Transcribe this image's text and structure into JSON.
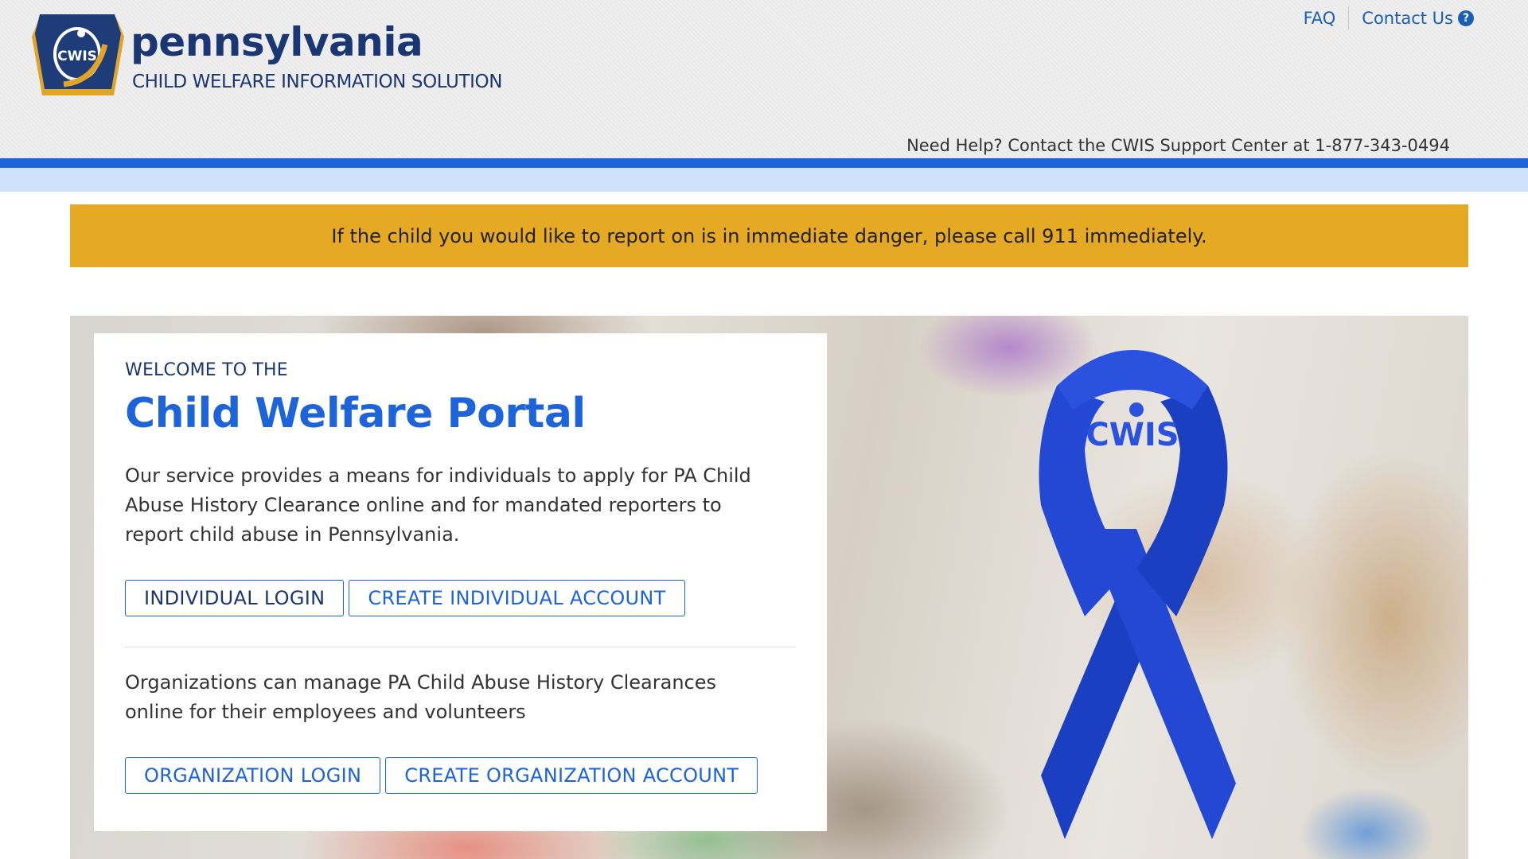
{
  "header": {
    "logo": {
      "state_name": "pennsylvania",
      "subtitle": "CHILD WELFARE INFORMATION SOLUTION",
      "badge_text": "CWIS"
    },
    "links": {
      "faq": "FAQ",
      "contact": "Contact Us"
    },
    "help_text": "Need Help? Contact the CWIS Support Center at 1-877-343-0494"
  },
  "alert": {
    "text": "If the child you would like to report on is in immediate danger, please call 911 immediately."
  },
  "hero": {
    "ribbon_text": "CWIS",
    "eyebrow": "WELCOME TO THE",
    "title": "Child Welfare Portal",
    "individual_description": "Our service provides a means for individuals to apply for PA Child Abuse History Clearance online and for mandated reporters to report child abuse in Pennsylvania.",
    "buttons_individual": {
      "login": "INDIVIDUAL LOGIN",
      "create": "CREATE INDIVIDUAL ACCOUNT"
    },
    "organization_description": "Organizations can manage PA Child Abuse History Clearances online for their employees and volunteers",
    "buttons_organization": {
      "login": "ORGANIZATION LOGIN",
      "create": "CREATE ORGANIZATION ACCOUNT"
    }
  },
  "colors": {
    "brand_navy": "#1a3673",
    "brand_blue": "#1d63d9",
    "alert_gold": "#e6a923",
    "light_band": "#cfe0fb"
  },
  "icons": [
    "cwis-keystone-logo-icon",
    "help-circle-icon",
    "awareness-ribbon-icon"
  ]
}
